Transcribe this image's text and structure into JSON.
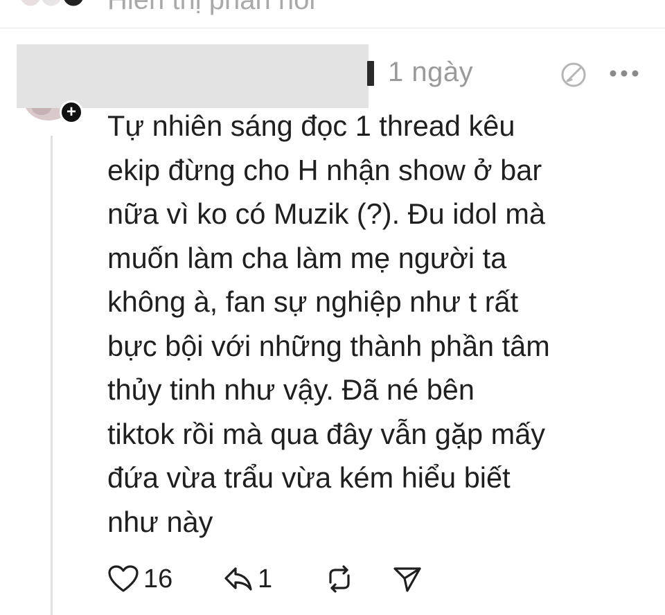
{
  "top_row": {
    "label": "Hiển thị phản hồi"
  },
  "post": {
    "time": "1 ngày",
    "text": "Tự nhiên sáng đọc 1 thread kêu\nekip đừng cho H nhận show ở bar\nnữa vì ko có Muzik (?). Đu idol mà\nmuốn làm cha làm mẹ người ta\nkhông à, fan sự nghiệp như t rất\nbực bội với những thành phần tâm\nthủy tinh như vậy. Đã né bên\ntiktok rồi mà qua đây vẫn gặp mấy\nđứa vừa trẩu vừa kém hiểu biết\nnhư này",
    "likes": "16",
    "replies": "1"
  },
  "icons": {
    "edit": "edit-icon",
    "more": "more-icon",
    "like": "heart-icon",
    "reply": "reply-icon",
    "repost": "repost-icon",
    "share": "share-icon",
    "follow": "plus-icon"
  },
  "colors": {
    "text": "#1f1f1f",
    "muted": "#9a9a9a",
    "redaction": "#e3e3e3",
    "thread_line": "#e1e1e1"
  }
}
